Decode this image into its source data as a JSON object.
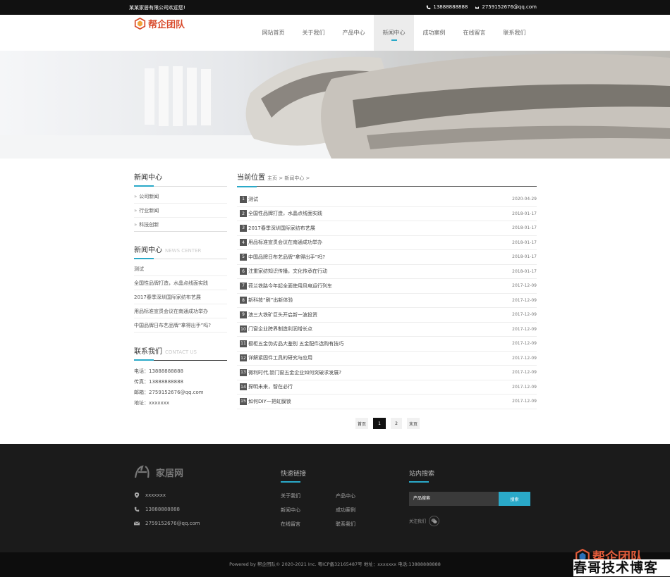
{
  "topbar": {
    "welcome": "某某家居有限公司欢迎您!",
    "phone": "13888888888",
    "email": "2759152676@qq.com"
  },
  "header": {
    "logo_text": "帮企团队",
    "nav": [
      "网站首页",
      "关于我们",
      "产品中心",
      "新闻中心",
      "成功案例",
      "在线留言",
      "联系我们"
    ],
    "active_nav": "新闻中心"
  },
  "sidebar": {
    "category_title": "新闻中心",
    "categories": [
      "公司新闻",
      "行业新闻",
      "科技创新"
    ],
    "news_title": "新闻中心",
    "news_title_en": "NEWS CENTER",
    "news": [
      "测试",
      "全国性品牌打造，水晶点线面实践",
      "2017春季深圳国际家纺布艺展",
      "用品标准宣贯会议在南通成功举办",
      "中国品牌日布艺品牌“拿得出手”吗?"
    ],
    "contact_title": "联系我们",
    "contact_title_en": "CONTACT US",
    "contact": [
      "电话：13888888888",
      "传真：13888888888",
      "邮箱：2759152676@qq.com",
      "地址：xxxxxxx"
    ]
  },
  "main": {
    "position_label": "当前位置",
    "breadcrumb": "主页 > 新闻中心 >",
    "articles": [
      {
        "num": "1",
        "title": "测试",
        "date": "2020-04-29"
      },
      {
        "num": "2",
        "title": "全国性品牌打造，水晶点线面实践",
        "date": "2018-01-17"
      },
      {
        "num": "3",
        "title": "2017春季深圳国际家纺布艺展",
        "date": "2018-01-17"
      },
      {
        "num": "4",
        "title": "用品标准宣贯会议在南通成功举办",
        "date": "2018-01-17"
      },
      {
        "num": "5",
        "title": "中国品牌日布艺品牌“拿得出手”吗?",
        "date": "2018-01-17"
      },
      {
        "num": "6",
        "title": "注重家纺知识传播，文化传承在行动",
        "date": "2018-01-17"
      },
      {
        "num": "7",
        "title": "荷兰铁路今年起全面使用风电运行列车",
        "date": "2017-12-09"
      },
      {
        "num": "8",
        "title": "新科技“刷”出新体验",
        "date": "2017-12-09"
      },
      {
        "num": "9",
        "title": "澳三大铁矿巨头开启新一波投资",
        "date": "2017-12-09"
      },
      {
        "num": "10",
        "title": "门窗企业跨界制造利润增长点",
        "date": "2017-12-09"
      },
      {
        "num": "11",
        "title": "橱柜五金伪劣品大鉴别 五金配件选购有技巧",
        "date": "2017-12-09"
      },
      {
        "num": "12",
        "title": "详解紧固件工具的研究与应用",
        "date": "2017-12-09"
      },
      {
        "num": "13",
        "title": "微利时代,锁门窗五金企业如何突破求发展?",
        "date": "2017-12-09"
      },
      {
        "num": "14",
        "title": "探明未来，智在必行",
        "date": "2017-12-09"
      },
      {
        "num": "15",
        "title": "如何DIY一把虹膜锁",
        "date": "2017-12-09"
      }
    ],
    "pager": {
      "first": "首页",
      "pages": [
        "1",
        "2"
      ],
      "current": "1",
      "last": "末页"
    }
  },
  "footer": {
    "logo_text": "家居网",
    "address": "xxxxxxx",
    "phone": "13888888888",
    "email": "2759152676@qq.com",
    "links_title": "快速链接",
    "links": [
      "关于我们",
      "产品中心",
      "新闻中心",
      "成功案例",
      "在线留言",
      "联系我们"
    ],
    "search_title": "站内搜索",
    "search_placeholder": "产品搜索",
    "search_button": "搜索",
    "follow_label": "关注我们",
    "copyright": "Powered by 帮企团队© 2020-2021 Inc.  粤ICP备32165487号  地址：xxxxxxx  电话:13888888888"
  },
  "watermark": {
    "logo": "帮企团队",
    "text": "春哥技术博客"
  },
  "colors": {
    "accent": "#2aa9c8",
    "dark": "#1b1b1b",
    "logo": "#d8492a"
  }
}
